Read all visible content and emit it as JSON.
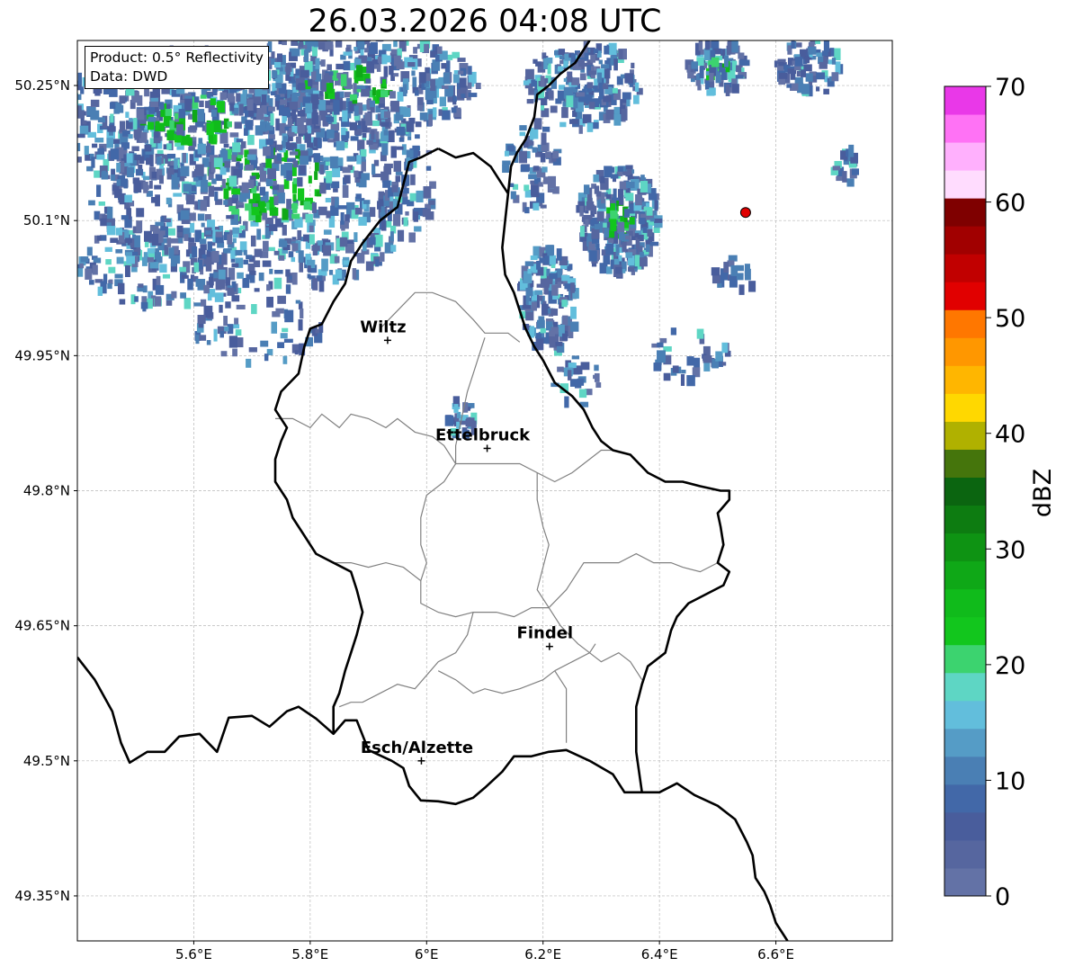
{
  "title": "26.03.2026 04:08 UTC",
  "info": {
    "product": "Product: 0.5° Reflectivity",
    "data": "Data: DWD"
  },
  "map": {
    "lon_range": [
      5.4,
      6.8
    ],
    "lat_range": [
      49.3,
      50.3
    ],
    "lon_ticks": [
      {
        "value": 5.6,
        "label": "5.6°E"
      },
      {
        "value": 5.8,
        "label": "5.8°E"
      },
      {
        "value": 6.0,
        "label": "6°E"
      },
      {
        "value": 6.2,
        "label": "6.2°E"
      },
      {
        "value": 6.4,
        "label": "6.4°E"
      },
      {
        "value": 6.6,
        "label": "6.6°E"
      }
    ],
    "lat_ticks": [
      {
        "value": 50.25,
        "label": "50.25°N"
      },
      {
        "value": 50.1,
        "label": "50.1°N"
      },
      {
        "value": 49.95,
        "label": "49.95°N"
      },
      {
        "value": 49.8,
        "label": "49.8°N"
      },
      {
        "value": 49.65,
        "label": "49.65°N"
      },
      {
        "value": 49.5,
        "label": "49.5°N"
      },
      {
        "value": 49.35,
        "label": "49.35°N"
      }
    ],
    "cities": [
      {
        "name": "Wiltz",
        "lon": 5.933,
        "lat": 49.967
      },
      {
        "name": "Ettelbruck",
        "lon": 6.104,
        "lat": 49.847
      },
      {
        "name": "Findel",
        "lon": 6.211,
        "lat": 49.627
      },
      {
        "name": "Esch/Alzette",
        "lon": 5.991,
        "lat": 49.5
      }
    ],
    "marker": {
      "lon": 6.548,
      "lat": 50.109,
      "color": "#e00000"
    },
    "borders": {
      "international": [
        [
          [
            5.4,
            49.615
          ],
          [
            5.43,
            49.59
          ],
          [
            5.46,
            49.555
          ],
          [
            5.475,
            49.52
          ],
          [
            5.49,
            49.498
          ],
          [
            5.52,
            49.51
          ],
          [
            5.55,
            49.51
          ],
          [
            5.575,
            49.527
          ],
          [
            5.61,
            49.53
          ],
          [
            5.64,
            49.51
          ],
          [
            5.66,
            49.548
          ],
          [
            5.7,
            49.55
          ],
          [
            5.73,
            49.538
          ],
          [
            5.76,
            49.555
          ],
          [
            5.78,
            49.56
          ],
          [
            5.81,
            49.547
          ],
          [
            5.84,
            49.53
          ],
          [
            5.86,
            49.545
          ],
          [
            5.88,
            49.545
          ],
          [
            5.9,
            49.512
          ],
          [
            5.94,
            49.5
          ],
          [
            5.96,
            49.492
          ],
          [
            5.97,
            49.472
          ],
          [
            5.99,
            49.456
          ],
          [
            6.02,
            49.455
          ],
          [
            6.05,
            49.452
          ],
          [
            6.08,
            49.459
          ],
          [
            6.1,
            49.47
          ],
          [
            6.13,
            49.488
          ],
          [
            6.15,
            49.505
          ],
          [
            6.18,
            49.505
          ],
          [
            6.21,
            49.51
          ],
          [
            6.24,
            49.512
          ],
          [
            6.28,
            49.5
          ],
          [
            6.32,
            49.485
          ],
          [
            6.34,
            49.465
          ],
          [
            6.37,
            49.465
          ],
          [
            6.4,
            49.465
          ],
          [
            6.43,
            49.475
          ],
          [
            6.46,
            49.462
          ],
          [
            6.5,
            49.45
          ],
          [
            6.53,
            49.435
          ],
          [
            6.55,
            49.41
          ],
          [
            6.56,
            49.395
          ],
          [
            6.565,
            49.37
          ],
          [
            6.58,
            49.355
          ],
          [
            6.59,
            49.34
          ],
          [
            6.6,
            49.32
          ],
          [
            6.62,
            49.3
          ]
        ],
        [
          [
            6.28,
            50.3
          ],
          [
            6.255,
            50.275
          ],
          [
            6.23,
            50.263
          ],
          [
            6.21,
            50.25
          ],
          [
            6.19,
            50.24
          ],
          [
            6.185,
            50.215
          ],
          [
            6.17,
            50.19
          ],
          [
            6.155,
            50.175
          ],
          [
            6.145,
            50.16
          ],
          [
            6.14,
            50.13
          ],
          [
            6.135,
            50.1
          ],
          [
            6.13,
            50.07
          ],
          [
            6.135,
            50.04
          ],
          [
            6.15,
            50.02
          ],
          [
            6.16,
            50.0
          ],
          [
            6.17,
            49.98
          ],
          [
            6.185,
            49.96
          ],
          [
            6.2,
            49.945
          ],
          [
            6.22,
            49.92
          ],
          [
            6.25,
            49.905
          ],
          [
            6.27,
            49.89
          ],
          [
            6.285,
            49.87
          ],
          [
            6.3,
            49.855
          ],
          [
            6.32,
            49.845
          ],
          [
            6.35,
            49.84
          ],
          [
            6.38,
            49.82
          ],
          [
            6.41,
            49.81
          ],
          [
            6.44,
            49.81
          ],
          [
            6.47,
            49.805
          ],
          [
            6.505,
            49.8
          ],
          [
            6.52,
            49.8
          ],
          [
            6.52,
            49.79
          ],
          [
            6.5,
            49.775
          ],
          [
            6.505,
            49.76
          ],
          [
            6.51,
            49.74
          ],
          [
            6.5,
            49.72
          ],
          [
            6.52,
            49.71
          ],
          [
            6.51,
            49.695
          ],
          [
            6.48,
            49.685
          ],
          [
            6.45,
            49.675
          ],
          [
            6.43,
            49.66
          ],
          [
            6.42,
            49.645
          ],
          [
            6.41,
            49.62
          ],
          [
            6.38,
            49.605
          ],
          [
            6.37,
            49.585
          ],
          [
            6.36,
            49.56
          ],
          [
            6.36,
            49.535
          ],
          [
            6.36,
            49.51
          ],
          [
            6.37,
            49.465
          ]
        ],
        [
          [
            6.02,
            50.18
          ],
          [
            6.05,
            50.17
          ],
          [
            6.08,
            50.175
          ],
          [
            6.11,
            50.16
          ],
          [
            6.13,
            50.14
          ],
          [
            6.14,
            50.13
          ]
        ],
        [
          [
            6.02,
            50.18
          ],
          [
            5.99,
            50.17
          ],
          [
            5.97,
            50.165
          ],
          [
            5.96,
            50.14
          ],
          [
            5.95,
            50.115
          ],
          [
            5.92,
            50.1
          ],
          [
            5.89,
            50.075
          ],
          [
            5.87,
            50.055
          ],
          [
            5.86,
            50.03
          ],
          [
            5.84,
            50.01
          ],
          [
            5.82,
            49.985
          ],
          [
            5.8,
            49.98
          ],
          [
            5.79,
            49.96
          ],
          [
            5.78,
            49.93
          ],
          [
            5.75,
            49.91
          ],
          [
            5.74,
            49.89
          ],
          [
            5.76,
            49.87
          ],
          [
            5.75,
            49.855
          ],
          [
            5.74,
            49.835
          ],
          [
            5.74,
            49.81
          ],
          [
            5.76,
            49.79
          ],
          [
            5.77,
            49.77
          ],
          [
            5.79,
            49.75
          ],
          [
            5.81,
            49.73
          ],
          [
            5.84,
            49.72
          ],
          [
            5.87,
            49.71
          ],
          [
            5.88,
            49.69
          ],
          [
            5.89,
            49.665
          ],
          [
            5.88,
            49.64
          ],
          [
            5.87,
            49.62
          ],
          [
            5.86,
            49.6
          ],
          [
            5.85,
            49.575
          ],
          [
            5.84,
            49.56
          ],
          [
            5.84,
            49.53
          ]
        ]
      ],
      "internal": [
        [
          [
            5.92,
            49.98
          ],
          [
            5.95,
            50.0
          ],
          [
            5.98,
            50.02
          ],
          [
            6.01,
            50.02
          ],
          [
            6.05,
            50.01
          ],
          [
            6.08,
            49.99
          ],
          [
            6.1,
            49.975
          ],
          [
            6.12,
            49.975
          ],
          [
            6.14,
            49.975
          ],
          [
            6.16,
            49.965
          ]
        ],
        [
          [
            5.74,
            49.88
          ],
          [
            5.77,
            49.88
          ],
          [
            5.8,
            49.87
          ],
          [
            5.82,
            49.885
          ],
          [
            5.85,
            49.87
          ],
          [
            5.87,
            49.885
          ],
          [
            5.9,
            49.88
          ],
          [
            5.93,
            49.87
          ],
          [
            5.95,
            49.88
          ],
          [
            5.98,
            49.865
          ],
          [
            6.01,
            49.86
          ],
          [
            6.03,
            49.85
          ],
          [
            6.05,
            49.83
          ],
          [
            6.09,
            49.83
          ],
          [
            6.12,
            49.83
          ],
          [
            6.16,
            49.83
          ],
          [
            6.19,
            49.82
          ],
          [
            6.22,
            49.81
          ],
          [
            6.25,
            49.82
          ],
          [
            6.27,
            49.83
          ],
          [
            6.3,
            49.845
          ],
          [
            6.32,
            49.845
          ]
        ],
        [
          [
            6.1,
            49.97
          ],
          [
            6.09,
            49.95
          ],
          [
            6.08,
            49.93
          ],
          [
            6.07,
            49.91
          ],
          [
            6.06,
            49.88
          ],
          [
            6.05,
            49.85
          ],
          [
            6.05,
            49.83
          ]
        ],
        [
          [
            6.05,
            49.83
          ],
          [
            6.03,
            49.81
          ],
          [
            6.0,
            49.795
          ],
          [
            5.99,
            49.77
          ],
          [
            5.99,
            49.74
          ],
          [
            6.0,
            49.72
          ],
          [
            5.99,
            49.7
          ],
          [
            5.99,
            49.675
          ],
          [
            6.02,
            49.665
          ],
          [
            6.05,
            49.66
          ],
          [
            6.08,
            49.665
          ],
          [
            6.12,
            49.665
          ],
          [
            6.15,
            49.66
          ],
          [
            6.18,
            49.67
          ],
          [
            6.21,
            49.67
          ]
        ],
        [
          [
            6.19,
            49.82
          ],
          [
            6.19,
            49.79
          ],
          [
            6.2,
            49.76
          ],
          [
            6.21,
            49.74
          ],
          [
            6.2,
            49.715
          ],
          [
            6.19,
            49.69
          ],
          [
            6.21,
            49.67
          ]
        ],
        [
          [
            6.21,
            49.67
          ],
          [
            6.24,
            49.69
          ],
          [
            6.27,
            49.72
          ],
          [
            6.3,
            49.72
          ],
          [
            6.33,
            49.72
          ],
          [
            6.36,
            49.73
          ],
          [
            6.39,
            49.72
          ],
          [
            6.42,
            49.72
          ],
          [
            6.44,
            49.715
          ],
          [
            6.47,
            49.71
          ],
          [
            6.5,
            49.72
          ]
        ],
        [
          [
            6.21,
            49.67
          ],
          [
            6.23,
            49.65
          ],
          [
            6.26,
            49.63
          ],
          [
            6.28,
            49.62
          ],
          [
            6.3,
            49.61
          ],
          [
            6.33,
            49.62
          ],
          [
            6.35,
            49.61
          ],
          [
            6.37,
            49.59
          ]
        ],
        [
          [
            6.08,
            49.665
          ],
          [
            6.07,
            49.64
          ],
          [
            6.05,
            49.62
          ],
          [
            6.02,
            49.61
          ],
          [
            6.0,
            49.595
          ],
          [
            5.98,
            49.58
          ],
          [
            5.95,
            49.585
          ],
          [
            5.92,
            49.575
          ],
          [
            5.89,
            49.565
          ],
          [
            5.87,
            49.565
          ],
          [
            5.85,
            49.56
          ]
        ],
        [
          [
            6.22,
            49.6
          ],
          [
            6.2,
            49.59
          ],
          [
            6.18,
            49.585
          ],
          [
            6.16,
            49.58
          ],
          [
            6.13,
            49.575
          ],
          [
            6.1,
            49.58
          ],
          [
            6.08,
            49.575
          ],
          [
            6.05,
            49.59
          ],
          [
            6.02,
            49.6
          ]
        ],
        [
          [
            6.22,
            49.6
          ],
          [
            6.24,
            49.58
          ],
          [
            6.24,
            49.56
          ],
          [
            6.24,
            49.52
          ]
        ],
        [
          [
            6.22,
            49.6
          ],
          [
            6.25,
            49.61
          ],
          [
            6.28,
            49.62
          ],
          [
            6.29,
            49.63
          ]
        ],
        [
          [
            5.84,
            49.72
          ],
          [
            5.87,
            49.72
          ],
          [
            5.9,
            49.715
          ],
          [
            5.93,
            49.72
          ],
          [
            5.96,
            49.715
          ],
          [
            5.99,
            49.7
          ]
        ]
      ]
    }
  },
  "colorbar": {
    "label": "dBZ",
    "vmin": 0,
    "vmax": 70,
    "step": 2.5,
    "ticks": [
      "0",
      "10",
      "20",
      "30",
      "40",
      "50",
      "60",
      "70"
    ],
    "colors": [
      "#6372a6",
      "#56669f",
      "#495d9c",
      "#4268a8",
      "#4a7fb4",
      "#559cc6",
      "#62bedc",
      "#5ed6c4",
      "#3cd36f",
      "#12c61d",
      "#10bb1b",
      "#0fa817",
      "#0e9313",
      "#0d7c11",
      "#0b6510",
      "#45750c",
      "#b0b100",
      "#ffd800",
      "#ffb600",
      "#ff9700",
      "#ff7700",
      "#e10000",
      "#c10000",
      "#a10000",
      "#7f0000",
      "#ffdcfe",
      "#ffb0fd",
      "#ff72f5",
      "#e938e8"
    ]
  },
  "legend_colors": {
    "low_echo": "#5567a2",
    "mid_echo": "#62bedc",
    "high_echo": "#12c61d",
    "marker": "#e00000"
  }
}
